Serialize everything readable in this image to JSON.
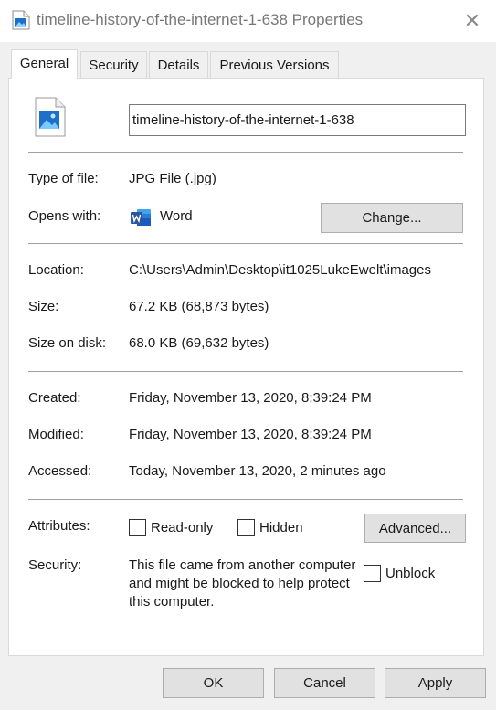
{
  "window": {
    "title": "timeline-history-of-the-internet-1-638 Properties",
    "close_glyph": "✕"
  },
  "tabs": [
    {
      "label": "General",
      "active": true
    },
    {
      "label": "Security",
      "active": false
    },
    {
      "label": "Details",
      "active": false
    },
    {
      "label": "Previous Versions",
      "active": false
    }
  ],
  "general": {
    "file_name": "timeline-history-of-the-internet-1-638",
    "type_label": "Type of file:",
    "type_value": "JPG File (.jpg)",
    "opens_label": "Opens with:",
    "opens_app": "Word",
    "change_button": "Change...",
    "location_label": "Location:",
    "location_value": "C:\\Users\\Admin\\Desktop\\it1025LukeEwelt\\images",
    "size_label": "Size:",
    "size_value": "67.2 KB (68,873 bytes)",
    "size_on_disk_label": "Size on disk:",
    "size_on_disk_value": "68.0 KB (69,632 bytes)",
    "created_label": "Created:",
    "created_value": "Friday, November 13, 2020, 8:39:24 PM",
    "modified_label": "Modified:",
    "modified_value": "Friday, November 13, 2020, 8:39:24 PM",
    "accessed_label": "Accessed:",
    "accessed_value": "Today, November 13, 2020, 2 minutes ago",
    "attributes_label": "Attributes:",
    "read_only_label": "Read-only",
    "hidden_label": "Hidden",
    "advanced_button": "Advanced...",
    "security_label": "Security:",
    "security_text": "This file came from another computer and might be blocked to help protect this computer.",
    "unblock_label": "Unblock"
  },
  "footer": {
    "ok": "OK",
    "cancel": "Cancel",
    "apply": "Apply"
  },
  "icons": {
    "title": "image-file-icon",
    "file": "image-file-icon",
    "app": "word-app-icon",
    "close": "close-icon"
  },
  "colors": {
    "word_blue": "#2b579a",
    "image_icon_blue": "#1e6fc9",
    "button_face": "#e1e1e1",
    "dialog_bg": "#f0f0f0"
  }
}
